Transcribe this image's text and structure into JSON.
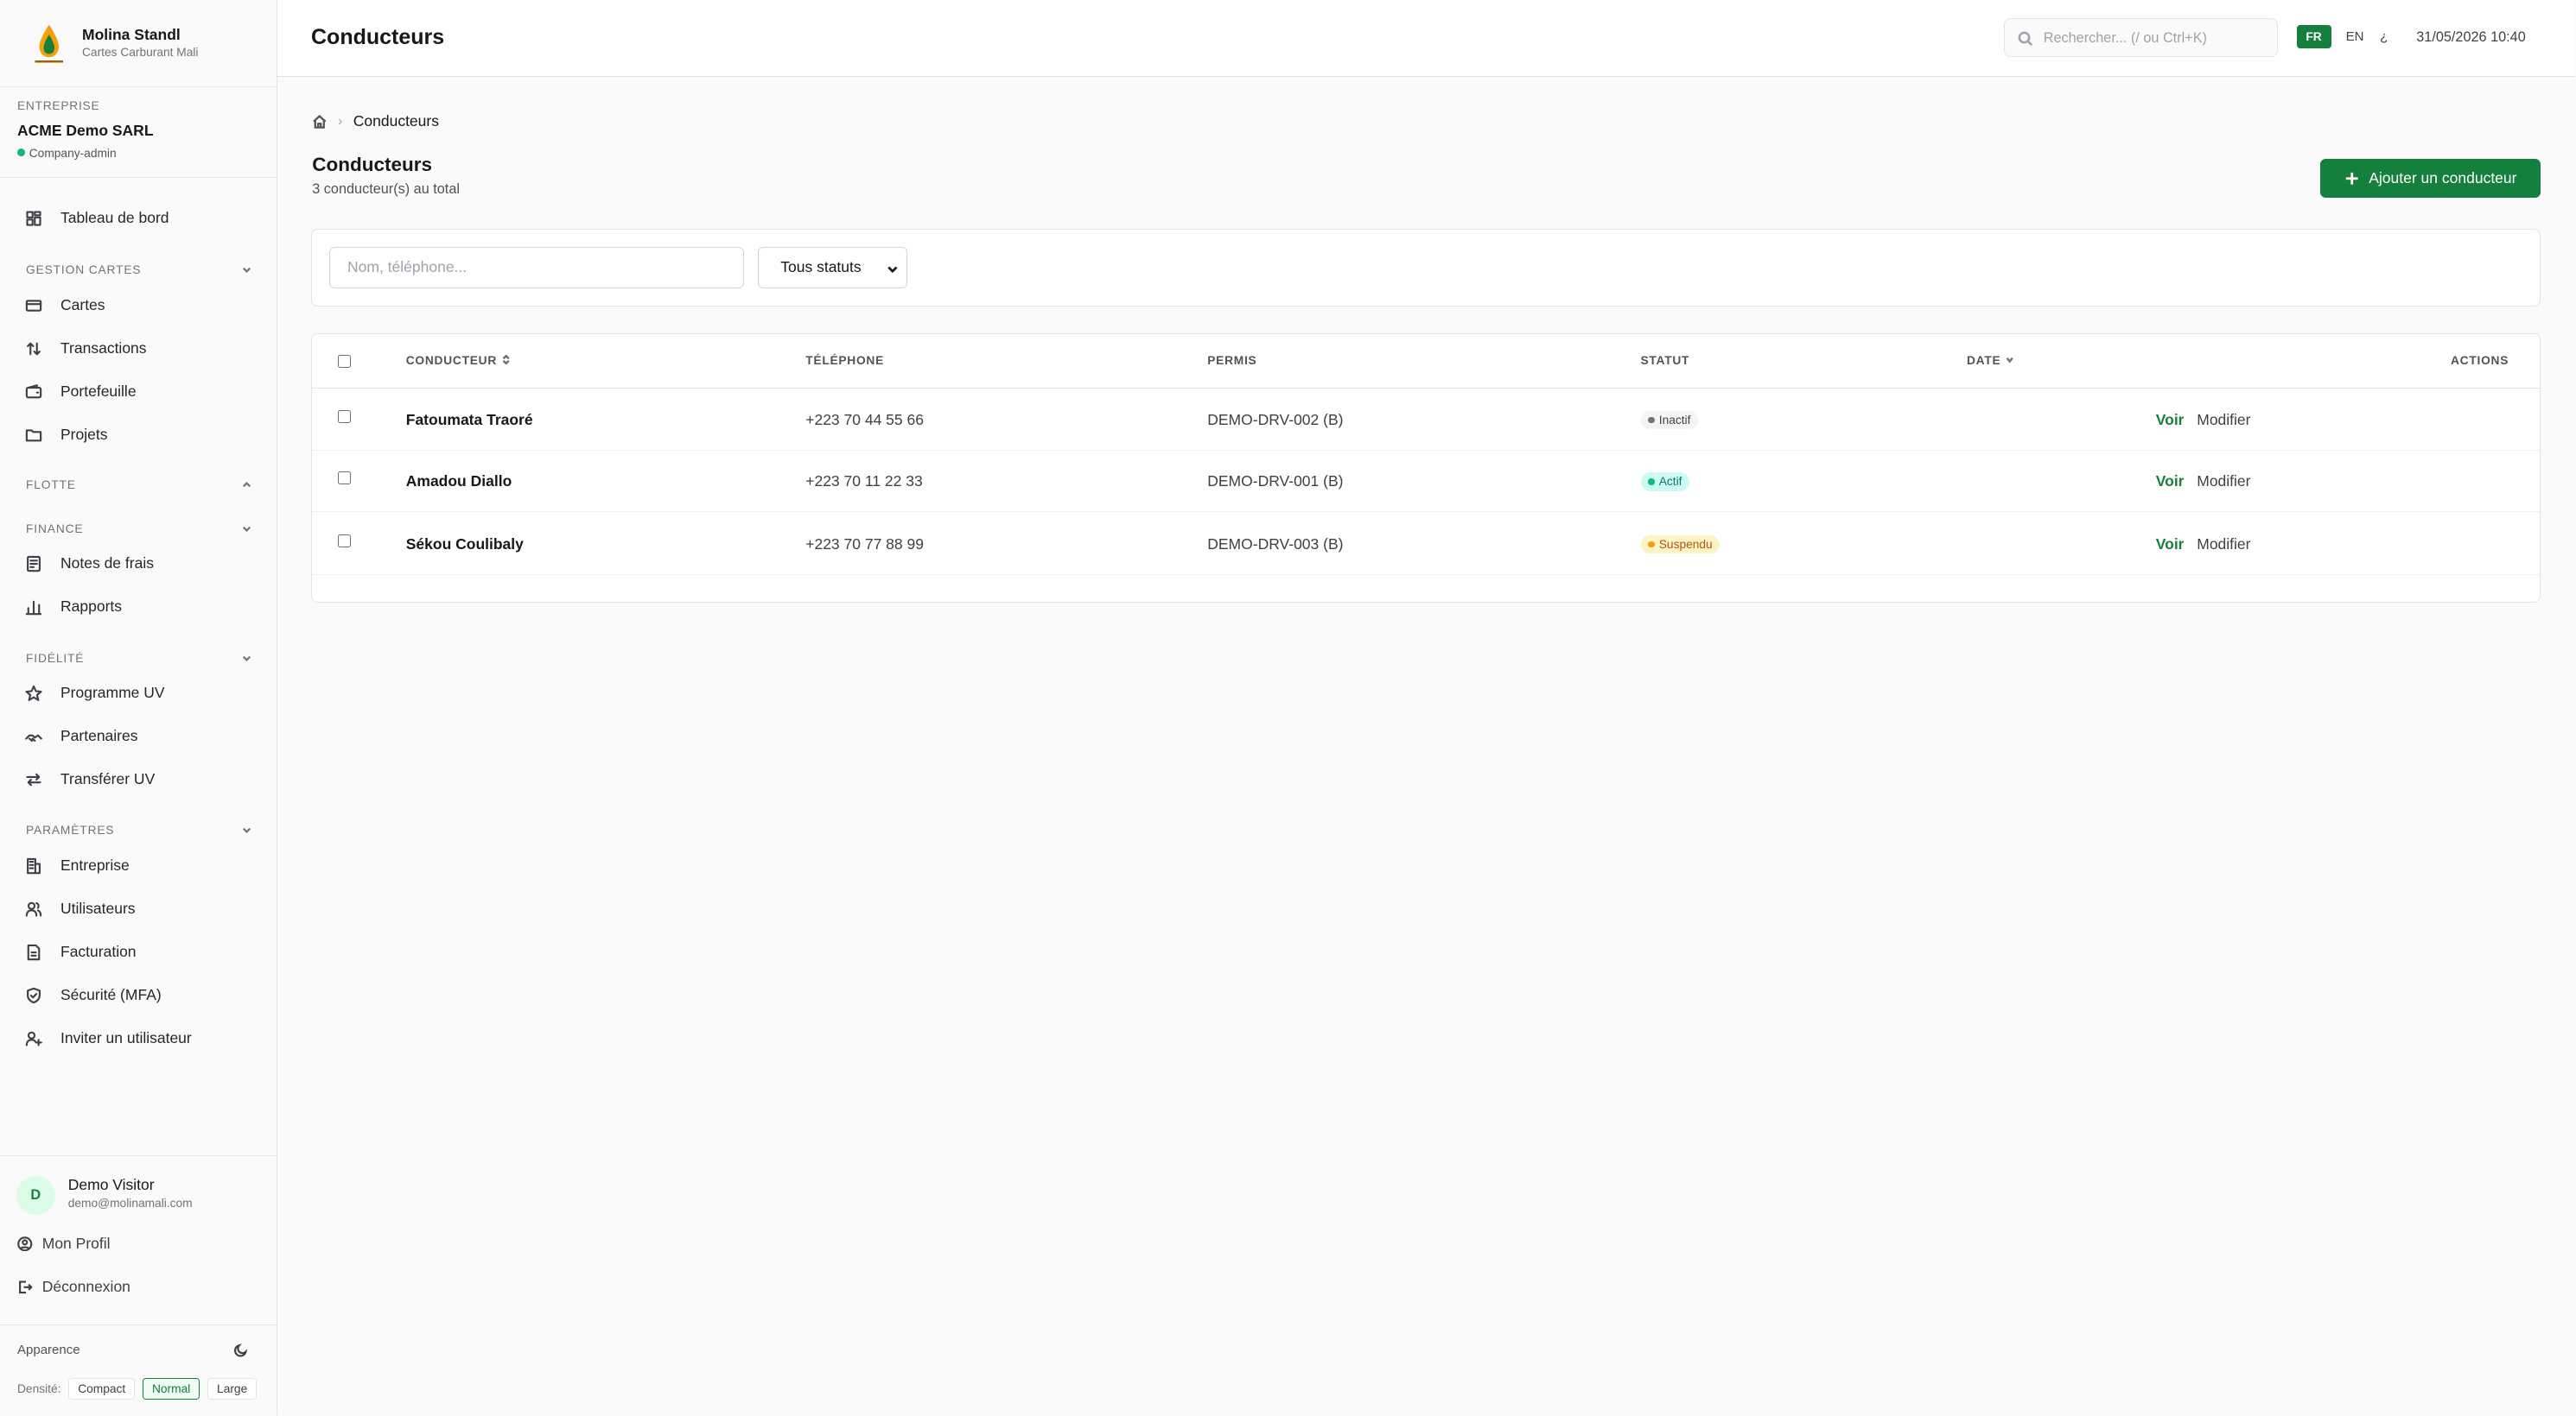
{
  "brand": {
    "name": "Molina Standl",
    "subtitle": "Cartes Carburant Mali"
  },
  "company": {
    "label": "ENTREPRISE",
    "name": "ACME Demo SARL",
    "role": "Company-admin"
  },
  "sidebar": {
    "dashboard": "Tableau de bord",
    "sections": [
      {
        "label": "GESTION CARTES",
        "items": [
          "Cartes",
          "Transactions",
          "Portefeuille",
          "Projets"
        ]
      },
      {
        "label": "FLOTTE",
        "items": []
      },
      {
        "label": "FINANCE",
        "items": [
          "Notes de frais",
          "Rapports"
        ]
      },
      {
        "label": "FIDÉLITÉ",
        "items": [
          "Programme UV",
          "Partenaires",
          "Transférer UV"
        ]
      },
      {
        "label": "PARAMÈTRES",
        "items": [
          "Entreprise",
          "Utilisateurs",
          "Facturation",
          "Sécurité (MFA)",
          "Inviter un utilisateur"
        ]
      }
    ]
  },
  "user": {
    "initial": "D",
    "name": "Demo Visitor",
    "email": "demo@molinamali.com",
    "profile": "Mon Profil",
    "logout": "Déconnexion"
  },
  "appearance": {
    "label": "Apparence",
    "density_label": "Densité:",
    "density_options": [
      "Compact",
      "Normal",
      "Large"
    ],
    "density_selected": "Normal"
  },
  "header": {
    "title": "Conducteurs",
    "search_placeholder": "Rechercher... (/ ou Ctrl+K)",
    "lang_active": "FR",
    "lang_other": "EN",
    "lang_more": "¿",
    "datetime": "31/05/2026 10:40"
  },
  "breadcrumb": {
    "current": "Conducteurs"
  },
  "page": {
    "title": "Conducteurs",
    "subtitle": "3 conducteur(s) au total",
    "add_button": "Ajouter un conducteur"
  },
  "filters": {
    "search_placeholder": "Nom, téléphone...",
    "status_selected": "Tous statuts"
  },
  "table": {
    "columns": [
      "CONDUCTEUR",
      "TÉLÉPHONE",
      "PERMIS",
      "STATUT",
      "DATE",
      "ACTIONS"
    ],
    "rows": [
      {
        "name": "Fatoumata Traoré",
        "phone": "+223 70 44 55 66",
        "permis": "DEMO-DRV-002 (B)",
        "status": "Inactif",
        "status_kind": "inactive"
      },
      {
        "name": "Amadou Diallo",
        "phone": "+223 70 11 22 33",
        "permis": "DEMO-DRV-001 (B)",
        "status": "Actif",
        "status_kind": "active"
      },
      {
        "name": "Sékou Coulibaly",
        "phone": "+223 70 77 88 99",
        "permis": "DEMO-DRV-003 (B)",
        "status": "Suspendu",
        "status_kind": "suspended"
      }
    ],
    "actions": {
      "view": "Voir",
      "edit": "Modifier"
    }
  },
  "colors": {
    "accent": "#15803d",
    "active_bg": "#ccfbf1",
    "active_fg": "#0f766e",
    "inactive_bg": "#f4f4f5",
    "inactive_fg": "#3f3f46",
    "suspended_bg": "#fef3c7",
    "suspended_fg": "#b45309"
  }
}
